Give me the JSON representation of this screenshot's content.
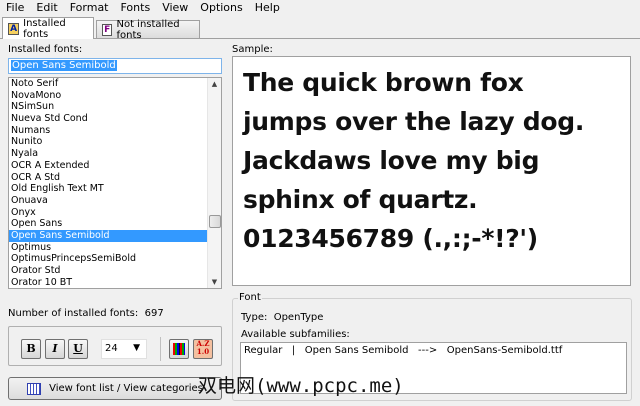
{
  "menu": [
    "File",
    "Edit",
    "Format",
    "Fonts",
    "View",
    "Options",
    "Help"
  ],
  "tabs": [
    {
      "label": "Installed fonts",
      "icon": "installed-fonts-icon",
      "active": true
    },
    {
      "label": "Not installed fonts",
      "icon": "not-installed-fonts-icon",
      "active": false
    }
  ],
  "left": {
    "installed_label": "Installed fonts:",
    "search_value": "Open Sans Semibold",
    "fonts": [
      "Noto Serif",
      "NovaMono",
      "NSimSun",
      "Nueva Std Cond",
      "Numans",
      "Nunito",
      "Nyala",
      "OCR A Extended",
      "OCR A Std",
      "Old English Text MT",
      "Onuava",
      "Onyx",
      "Open Sans",
      "Open Sans Semibold",
      "Optimus",
      "OptimusPrincepsSemiBold",
      "Orator Std",
      "Orator 10 BT"
    ],
    "selected": "Open Sans Semibold",
    "count_label": "Number of installed fonts:",
    "count": "697",
    "bold": "B",
    "italic": "I",
    "underline": "U",
    "size": "24",
    "view_button": "View font list / View categories"
  },
  "sample": {
    "label": "Sample:",
    "lines": [
      "The quick brown fox",
      "jumps over the lazy dog.",
      "Jackdaws love my big",
      "sphinx of quartz.",
      "0123456789 (.,:;-*!?')"
    ]
  },
  "font_info": {
    "legend": "Font",
    "type_label": "Type:",
    "type": "OpenType",
    "subfamilies_label": "Available subfamilies:",
    "subfamilies": [
      "Regular   |   Open Sans Semibold   --->   OpenSans-Semibold.ttf"
    ]
  },
  "watermark": "双电网(www.pcpc.me)",
  "colors": {
    "selection": "#3399ff"
  }
}
